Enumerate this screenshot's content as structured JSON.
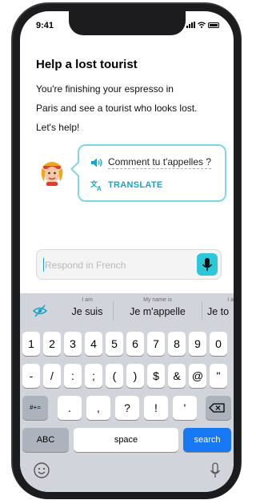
{
  "status": {
    "time": "9:41"
  },
  "lesson": {
    "title": "Help a lost tourist",
    "intro_lines": [
      "You're finishing your espresso in",
      "Paris and see a tourist who looks lost.",
      "Let's help!"
    ]
  },
  "bubble": {
    "phrase": "Comment tu t'appelles ?",
    "translate_label": "TRANSLATE"
  },
  "input": {
    "placeholder": "Respond in French"
  },
  "suggestions": [
    {
      "hint": "I am",
      "word": "Je suis"
    },
    {
      "hint": "My name is",
      "word": "Je m'appelle"
    },
    {
      "hint": "I a",
      "word": "Je to"
    }
  ],
  "keyboard": {
    "row1": [
      "1",
      "2",
      "3",
      "4",
      "5",
      "6",
      "7",
      "8",
      "9",
      "0"
    ],
    "row2": [
      "-",
      "/",
      ":",
      ";",
      "(",
      ")",
      "$",
      "&",
      "@",
      "\""
    ],
    "row3_toggle": "#+=",
    "row3": [
      ".",
      ",",
      "?",
      "!",
      "'"
    ],
    "abc_label": "ABC",
    "space_label": "space",
    "search_label": "search"
  },
  "colors": {
    "accent": "#1aa3c9",
    "bubble_border": "#7fd6e6",
    "mic": "#2cc7d9",
    "search_key": "#1877f2"
  }
}
